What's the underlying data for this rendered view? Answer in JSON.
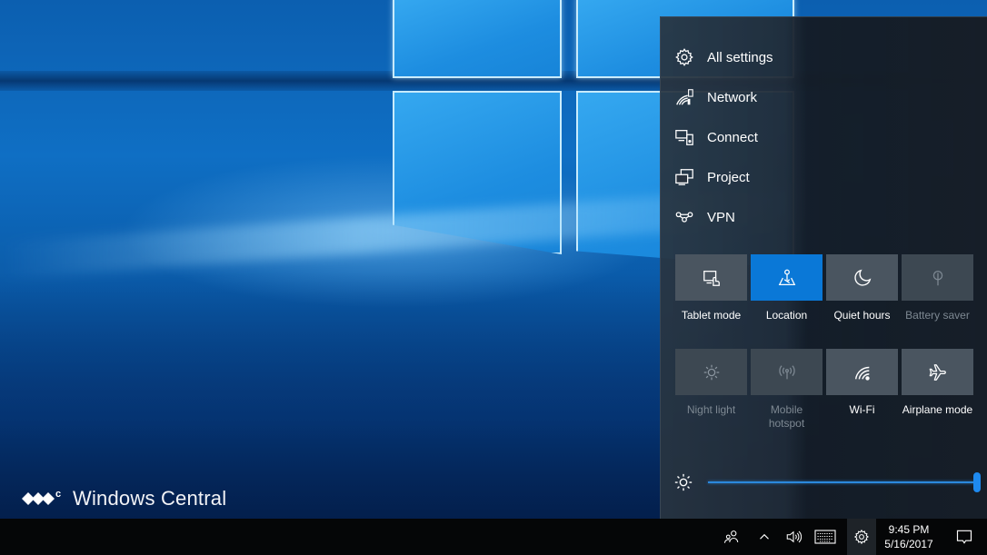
{
  "watermark": {
    "text": "Windows Central"
  },
  "action_center": {
    "quick_links": [
      {
        "icon": "gear-icon",
        "label": "All settings"
      },
      {
        "icon": "network-icon",
        "label": "Network"
      },
      {
        "icon": "connect-icon",
        "label": "Connect"
      },
      {
        "icon": "project-icon",
        "label": "Project"
      },
      {
        "icon": "vpn-icon",
        "label": "VPN"
      }
    ],
    "tiles": [
      {
        "icon": "tablet-mode-icon",
        "label": "Tablet mode",
        "state": "off"
      },
      {
        "icon": "location-icon",
        "label": "Location",
        "state": "on"
      },
      {
        "icon": "moon-icon",
        "label": "Quiet hours",
        "state": "off"
      },
      {
        "icon": "battery-saver-icon",
        "label": "Battery saver",
        "state": "disabled"
      },
      {
        "icon": "night-light-icon",
        "label": "Night light",
        "state": "disabled"
      },
      {
        "icon": "mobile-hotspot-icon",
        "label": "Mobile hotspot",
        "state": "disabled"
      },
      {
        "icon": "wifi-icon",
        "label": "Wi-Fi",
        "state": "off"
      },
      {
        "icon": "airplane-icon",
        "label": "Airplane mode",
        "state": "off"
      }
    ],
    "brightness": {
      "icon": "brightness-icon",
      "value_percent": 100
    },
    "accent_color": "#0a78d7"
  },
  "taskbar": {
    "tray": {
      "people": "people-icon",
      "show_hidden": "chevron-up-icon",
      "volume": "speaker-icon",
      "keyboard": "touch-keyboard-icon",
      "settings": "gear-icon",
      "notifications": "action-center-icon"
    },
    "clock": {
      "time": "9:45 PM",
      "date": "5/16/2017"
    }
  }
}
